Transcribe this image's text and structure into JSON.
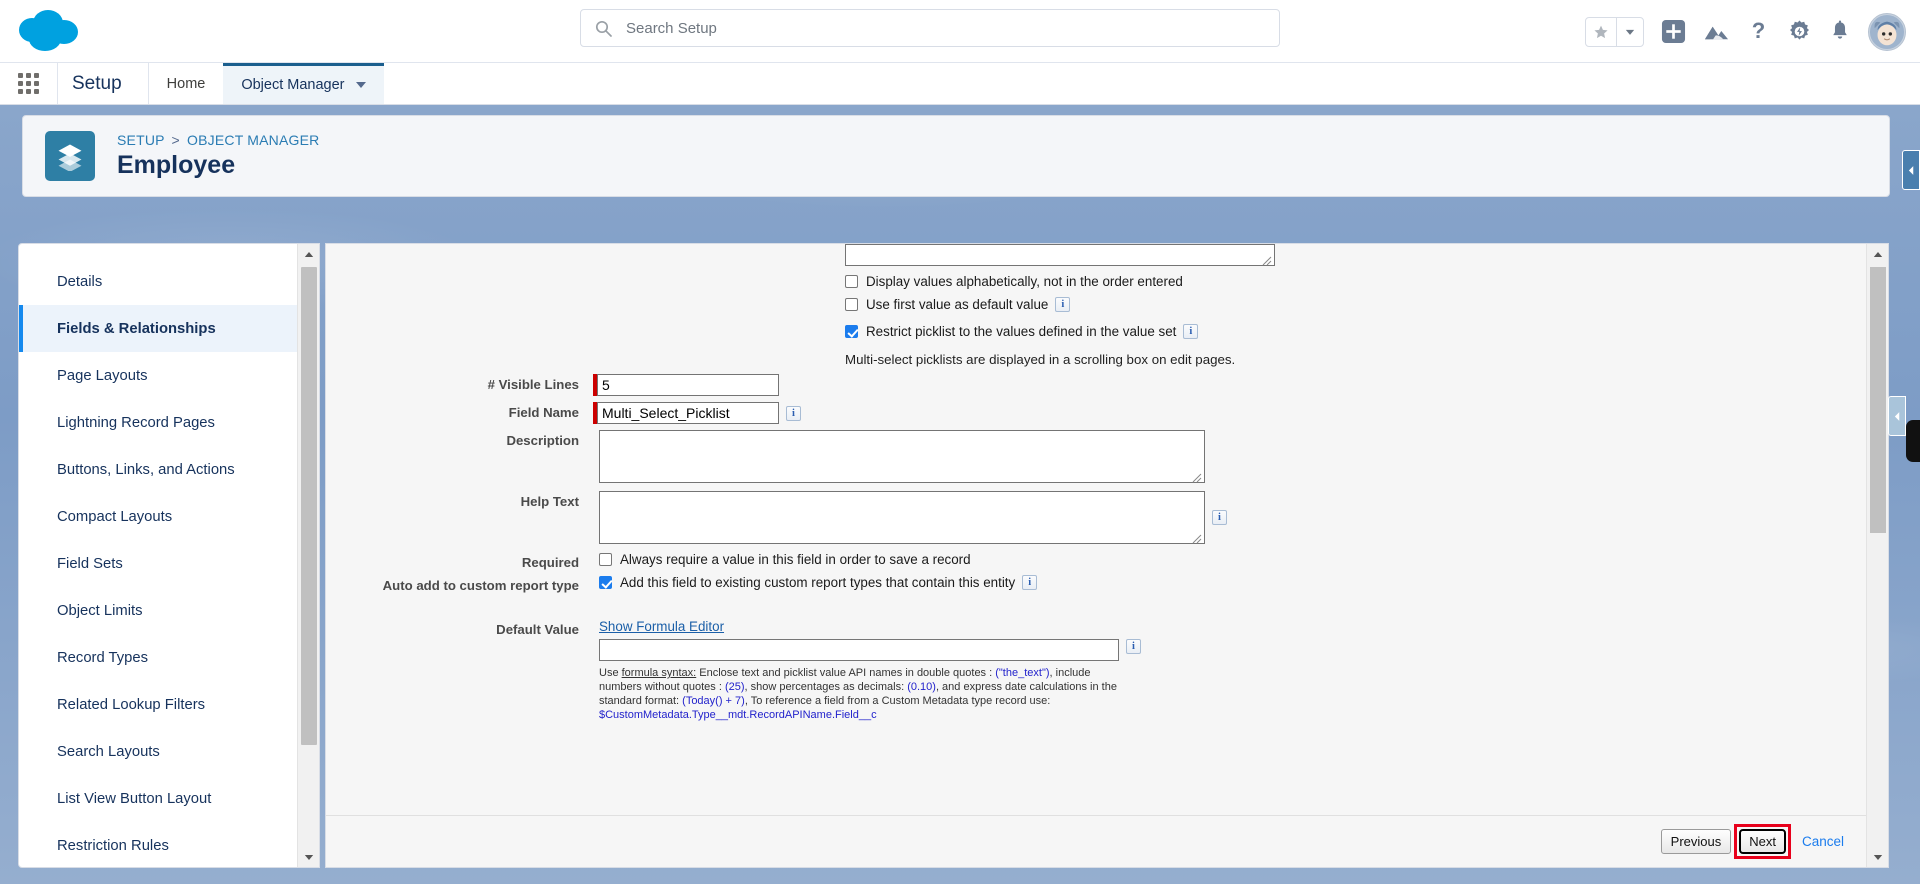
{
  "header": {
    "logo_icon": "salesforce-cloud-logo",
    "search": {
      "placeholder": "Search Setup",
      "value": "",
      "icon": "search-icon"
    },
    "icons": [
      {
        "name": "favorites-star-icon",
        "glyph": "star"
      },
      {
        "name": "favorites-dropdown-icon",
        "glyph": "caret-down"
      },
      {
        "name": "add-icon",
        "glyph": "plus-square"
      },
      {
        "name": "trailhead-icon",
        "glyph": "mountain"
      },
      {
        "name": "help-icon",
        "glyph": "question-mark"
      },
      {
        "name": "setup-gear-icon",
        "glyph": "gear-lightning"
      },
      {
        "name": "notifications-bell-icon",
        "glyph": "bell"
      },
      {
        "name": "user-avatar",
        "glyph": "astro-avatar"
      }
    ]
  },
  "setup_nav": {
    "app_launcher_label": "App Launcher",
    "setup_label": "Setup",
    "tabs": [
      {
        "label": "Home",
        "active": false,
        "has_caret": false
      },
      {
        "label": "Object Manager",
        "active": true,
        "has_caret": true
      }
    ]
  },
  "object_header": {
    "icon": "object-layers-icon",
    "breadcrumb": {
      "first": "SETUP",
      "separator": ">",
      "second": "OBJECT MANAGER"
    },
    "title": "Employee"
  },
  "sidebar": {
    "items": [
      {
        "label": "Details",
        "active": false
      },
      {
        "label": "Fields & Relationships",
        "active": true
      },
      {
        "label": "Page Layouts",
        "active": false
      },
      {
        "label": "Lightning Record Pages",
        "active": false
      },
      {
        "label": "Buttons, Links, and Actions",
        "active": false
      },
      {
        "label": "Compact Layouts",
        "active": false
      },
      {
        "label": "Field Sets",
        "active": false
      },
      {
        "label": "Object Limits",
        "active": false
      },
      {
        "label": "Record Types",
        "active": false
      },
      {
        "label": "Related Lookup Filters",
        "active": false
      },
      {
        "label": "Search Layouts",
        "active": false
      },
      {
        "label": "List View Button Layout",
        "active": false
      },
      {
        "label": "Restriction Rules",
        "active": false
      }
    ],
    "scrollbar": {
      "up_icon": "scroll-up-arrow",
      "down_icon": "scroll-down-arrow"
    }
  },
  "form": {
    "values_textarea": "",
    "checkboxes": [
      {
        "label": "Display values alphabetically, not in the order entered",
        "checked": false,
        "info": false
      },
      {
        "label": "Use first value as default value",
        "checked": false,
        "info": true
      },
      {
        "label": "Restrict picklist to the values defined in the value set",
        "checked": true,
        "info": true
      }
    ],
    "multiselect_note": "Multi-select picklists are displayed in a scrolling box on edit pages.",
    "visible_lines": {
      "label": "# Visible Lines",
      "value": "5",
      "required": true
    },
    "field_name": {
      "label": "Field Name",
      "value": "Multi_Select_Picklist",
      "required": true,
      "info": true
    },
    "description": {
      "label": "Description",
      "value": ""
    },
    "help_text": {
      "label": "Help Text",
      "value": "",
      "info": true
    },
    "required": {
      "label": "Required",
      "checkbox_label": "Always require a value in this field in order to save a record",
      "checked": false
    },
    "auto_add_report": {
      "label": "Auto add to custom report type",
      "checkbox_label": "Add this field to existing custom report types that contain this entity",
      "checked": true,
      "info": true
    },
    "default_value": {
      "label": "Default Value",
      "link": "Show Formula Editor",
      "value": "",
      "info": true,
      "help": {
        "p1_a": "Use ",
        "p1_syntax": "formula syntax:",
        "p1_b": " Enclose text and picklist value API names in double quotes : ",
        "p1_code": "(\"the_text\")",
        "p1_c": ", include numbers without quotes",
        "p2_a": ": ",
        "p2_code1": "(25)",
        "p2_b": ", show percentages as decimals: ",
        "p2_code2": "(0.10)",
        "p2_c": ", and express date calculations in the standard format: ",
        "p2_code3": "(Today() + 7)",
        "p2_d": ", To",
        "p3_a": "reference a field from a Custom Metadata type record use: ",
        "p3_code": "$CustomMetadata.Type__mdt.RecordAPIName.Field__c"
      }
    }
  },
  "footer": {
    "previous_label": "Previous",
    "next_label": "Next",
    "cancel_label": "Cancel",
    "highlight_color": "#e8001b"
  },
  "colors": {
    "brand_blue": "#1589ee",
    "header_blue": "#16325c",
    "link_blue": "#1b7ced",
    "required_red": "#cc0000",
    "object_icon": "#2e7fa5",
    "page_background": "#7c9bc4"
  }
}
